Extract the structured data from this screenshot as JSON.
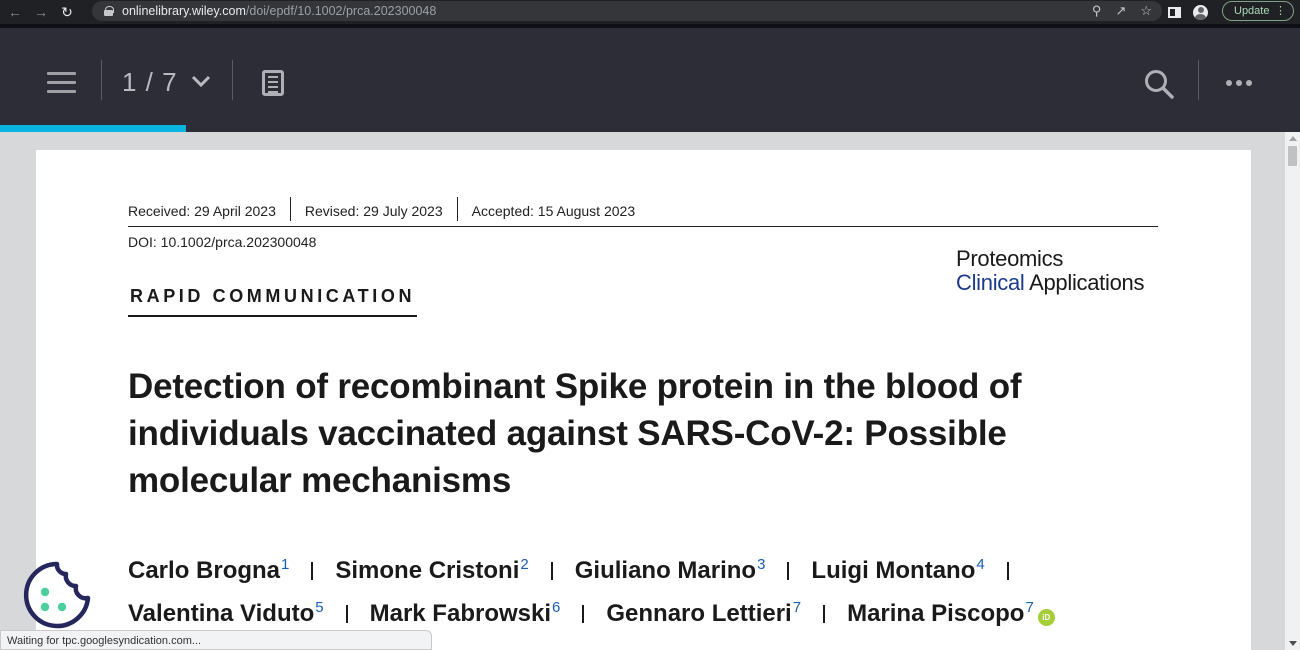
{
  "browser": {
    "url_host": "onlinelibrary.wiley.com",
    "url_path": "/doi/epdf/10.1002/prca.202300048",
    "update_label": "Update",
    "status_text": "Waiting for tpc.googlesyndication.com..."
  },
  "viewer": {
    "page_indicator": "1 / 7",
    "progress_fraction": 0.143,
    "accent_color": "#0ab4e0"
  },
  "article": {
    "received": "Received: 29 April 2023",
    "revised": "Revised: 29 July 2023",
    "accepted": "Accepted: 15 August 2023",
    "doi": "DOI: 10.1002/prca.202300048",
    "journal_line1": "Proteomics",
    "journal_line2_blue": "Clinical",
    "journal_line2_rest": " Applications",
    "section": "RAPID COMMUNICATION",
    "title": "Detection of recombinant Spike protein in the blood of individuals vaccinated against SARS-CoV-2: Possible molecular mechanisms",
    "authors": [
      {
        "name": "Carlo Brogna",
        "aff": "1"
      },
      {
        "name": "Simone Cristoni",
        "aff": "2"
      },
      {
        "name": "Giuliano Marino",
        "aff": "3"
      },
      {
        "name": "Luigi Montano",
        "aff": "4"
      },
      {
        "name": "Valentina Viduto",
        "aff": "5"
      },
      {
        "name": "Mark Fabrowski",
        "aff": "6"
      },
      {
        "name": "Gennaro Lettieri",
        "aff": "7"
      },
      {
        "name": "Marina Piscopo",
        "aff": "7"
      }
    ],
    "orcid_label": "iD"
  }
}
